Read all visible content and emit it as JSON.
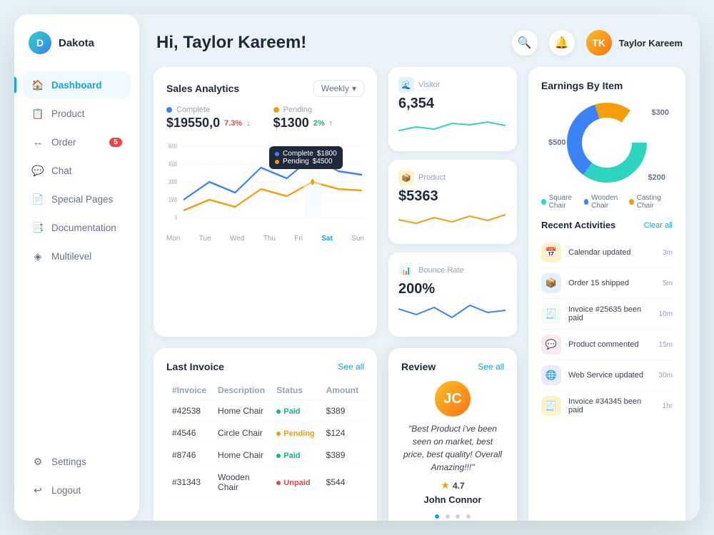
{
  "app": {
    "name": "Dakota"
  },
  "sidebar": {
    "items": [
      {
        "id": "dashboard",
        "label": "Dashboard",
        "icon": "🏠",
        "active": true,
        "badge": null
      },
      {
        "id": "product",
        "label": "Product",
        "icon": "📋",
        "active": false,
        "badge": null
      },
      {
        "id": "order",
        "label": "Order",
        "icon": "↔",
        "active": false,
        "badge": "5"
      },
      {
        "id": "chat",
        "label": "Chat",
        "icon": "💬",
        "active": false,
        "badge": null
      },
      {
        "id": "special-pages",
        "label": "Special Pages",
        "icon": "📄",
        "active": false,
        "badge": null
      },
      {
        "id": "documentation",
        "label": "Documentation",
        "icon": "📑",
        "active": false,
        "badge": null
      },
      {
        "id": "multilevel",
        "label": "Multilevel",
        "icon": "◈",
        "active": false,
        "badge": null
      }
    ],
    "bottom_items": [
      {
        "id": "settings",
        "label": "Settings",
        "icon": "⚙"
      },
      {
        "id": "logout",
        "label": "Logout",
        "icon": "↩"
      }
    ]
  },
  "header": {
    "greeting": "Hi, Taylor Kareem!",
    "user_name": "Taylor Kareem"
  },
  "analytics": {
    "title": "Sales Analytics",
    "period_btn": "Weekly",
    "complete_label": "Complete",
    "complete_value": "$19550,0",
    "complete_change": "7.3%",
    "complete_change_dir": "down",
    "pending_label": "Pending",
    "pending_value": "$1300",
    "pending_change": "2%",
    "pending_change_dir": "up",
    "x_labels": [
      "Mon",
      "Tue",
      "Wed",
      "Thu",
      "Fri",
      "Sat",
      "Sun"
    ],
    "y_labels": [
      "6000",
      "4500",
      "3000",
      "1500",
      "0"
    ],
    "tooltip": {
      "complete_label": "Complete",
      "complete_value": "$1800",
      "pending_label": "Pending",
      "pending_value": "$4500"
    }
  },
  "stats": [
    {
      "id": "visitor",
      "label": "Visitor",
      "value": "6,354",
      "icon": "🌊",
      "icon_bg": "#e0f2fe"
    },
    {
      "id": "product",
      "label": "Product",
      "value": "$5363",
      "icon": "📦",
      "icon_bg": "#fef3c7"
    },
    {
      "id": "bounce-rate",
      "label": "Bounce Rate",
      "value": "200%",
      "icon": "📊",
      "icon_bg": "#f0fdf4"
    }
  ],
  "earnings": {
    "title": "Earnings By Item",
    "segments": [
      {
        "label": "Square Chair",
        "value": "$500",
        "color": "#2dd4bf",
        "percent": 35
      },
      {
        "label": "Wooden Chair",
        "value": "",
        "color": "#3b82f6",
        "percent": 35
      },
      {
        "label": "Casting Chair",
        "value": "$200",
        "color": "#f59e0b",
        "percent": 15
      }
    ],
    "right_value": "$300"
  },
  "activities": {
    "title": "Recent Activities",
    "clear_all": "Clear all",
    "items": [
      {
        "icon": "📅",
        "text": "Calendar updated",
        "time": "3m",
        "icon_bg": "#fef3c7"
      },
      {
        "icon": "📦",
        "text": "Order 15 shipped",
        "time": "5m",
        "icon_bg": "#e0f2fe"
      },
      {
        "icon": "🧾",
        "text": "Invoice #25635 been paid",
        "time": "10m",
        "icon_bg": "#f0fdf4"
      },
      {
        "icon": "💬",
        "text": "Product commented",
        "time": "15m",
        "icon_bg": "#fce7f3"
      },
      {
        "icon": "🌐",
        "text": "Web Service updated",
        "time": "30m",
        "icon_bg": "#ede9fe"
      },
      {
        "icon": "🧾",
        "text": "Invoice #34345 been paid",
        "time": "1hr",
        "icon_bg": "#fef3c7"
      }
    ]
  },
  "invoice": {
    "title": "Last Invoice",
    "see_all": "See all",
    "columns": [
      "#Invoice",
      "Description",
      "Status",
      "Amount"
    ],
    "rows": [
      {
        "invoice": "#42538",
        "desc": "Home Chair",
        "status": "Paid",
        "amount": "$389"
      },
      {
        "invoice": "#4546",
        "desc": "Circle Chair",
        "status": "Pending",
        "amount": "$124"
      },
      {
        "invoice": "#8746",
        "desc": "Home Chair",
        "status": "Paid",
        "amount": "$389"
      },
      {
        "invoice": "#31343",
        "desc": "Wooden Chair",
        "status": "Unpaid",
        "amount": "$544"
      }
    ]
  },
  "review": {
    "title": "Review",
    "see_all": "See all",
    "quote": "\"Best Product i've been seen on market, best price, best quality! Overall Amazing!!!\"",
    "rating": "4.7",
    "reviewer": "John Connor",
    "dots": 4,
    "active_dot": 0
  }
}
